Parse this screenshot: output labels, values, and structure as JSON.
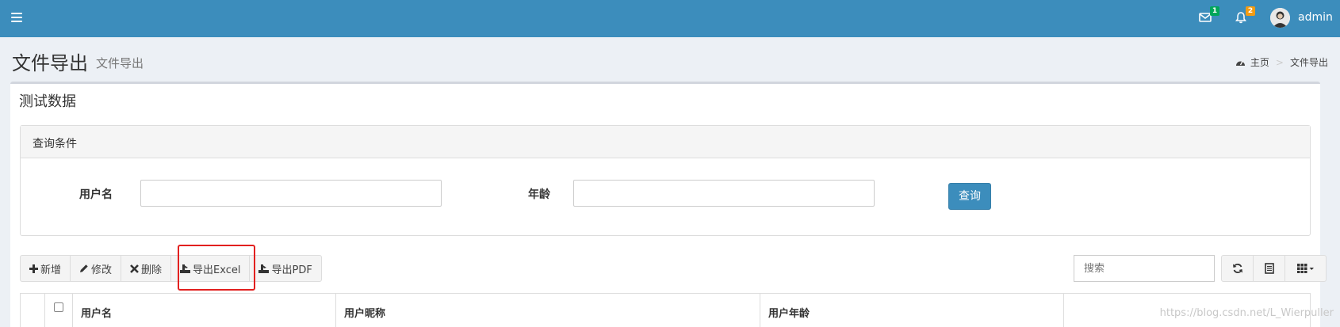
{
  "header": {
    "mail_badge": "1",
    "notice_badge": "2",
    "username": "admin"
  },
  "page": {
    "title": "文件导出",
    "subtitle": "文件导出"
  },
  "breadcrumb": {
    "home": "主页",
    "current": "文件导出"
  },
  "box": {
    "title": "测试数据"
  },
  "query": {
    "panel_title": "查询条件",
    "username_label": "用户名",
    "username_value": "",
    "age_label": "年龄",
    "age_value": "",
    "submit_label": "查询"
  },
  "toolbar": {
    "add_label": "新增",
    "edit_label": "修改",
    "delete_label": "删除",
    "excel_label": "导出Excel",
    "pdf_label": "导出PDF"
  },
  "search": {
    "placeholder": "搜索"
  },
  "table": {
    "columns": [
      "用户名",
      "用户昵称",
      "用户年龄"
    ]
  },
  "watermark": "https://blog.csdn.net/L_Wierpuller",
  "colors": {
    "header": "#3c8dbc",
    "highlight": "#e2201f"
  }
}
